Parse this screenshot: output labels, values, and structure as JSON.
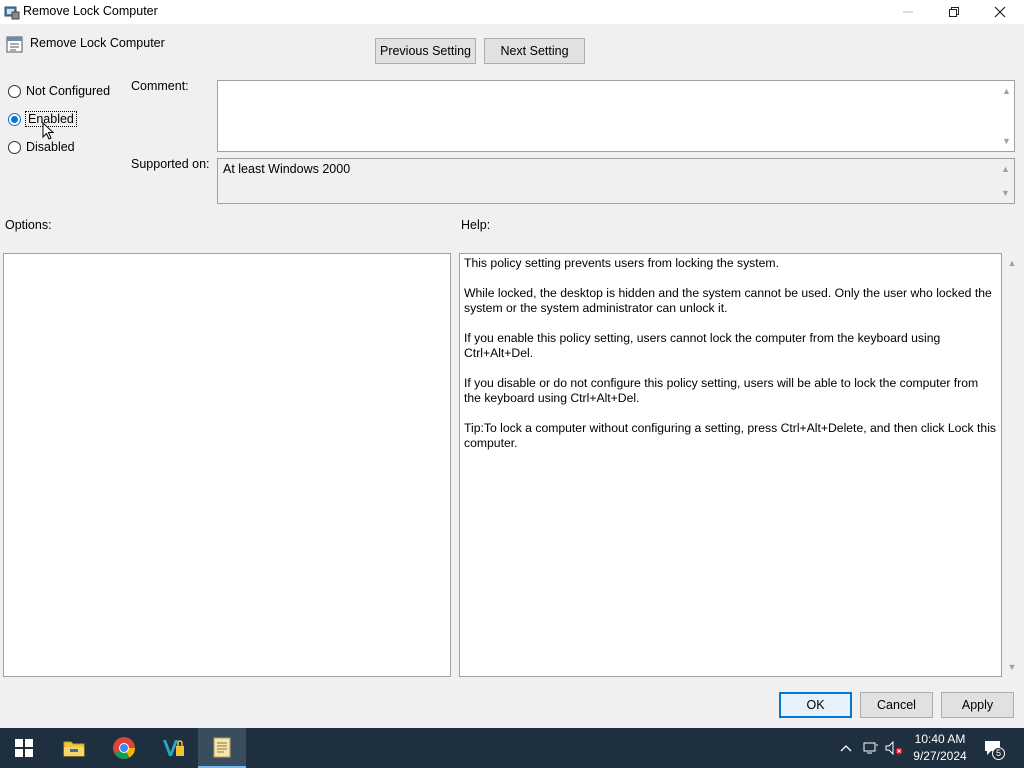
{
  "window": {
    "title": "Remove Lock Computer",
    "policy_name": "Remove Lock Computer"
  },
  "nav": {
    "previous_label": "Previous Setting",
    "next_label": "Next Setting"
  },
  "state": {
    "options": [
      {
        "label": "Not Configured",
        "checked": false
      },
      {
        "label": "Enabled",
        "checked": true
      },
      {
        "label": "Disabled",
        "checked": false
      }
    ]
  },
  "comment": {
    "label": "Comment:",
    "value": ""
  },
  "supported": {
    "label": "Supported on:",
    "value": "At least Windows 2000"
  },
  "options_panel": {
    "label": "Options:"
  },
  "help": {
    "label": "Help:",
    "paragraphs": [
      "This policy setting prevents users from locking the system.",
      "While locked, the desktop is hidden and the system cannot be used. Only the user who locked the system or the system administrator can unlock it.",
      "If you enable this policy setting, users cannot lock the computer from the keyboard using Ctrl+Alt+Del.",
      "If you disable or do not configure this policy setting, users will be able to lock the computer from the keyboard using Ctrl+Alt+Del.",
      "Tip:To lock a computer without configuring a setting, press Ctrl+Alt+Delete, and then click Lock this computer."
    ]
  },
  "buttons": {
    "ok": "OK",
    "cancel": "Cancel",
    "apply": "Apply"
  },
  "taskbar": {
    "time": "10:40 AM",
    "date": "9/27/2024",
    "notification_count": "5",
    "apps": [
      "start-icon",
      "file-explorer-icon",
      "chrome-icon",
      "vs-code-icon",
      "notepad-icon"
    ]
  },
  "colors": {
    "accent": "#0078d7",
    "taskbar_bg": "#1e2f3f",
    "dialog_bg": "#f0f0f0"
  }
}
